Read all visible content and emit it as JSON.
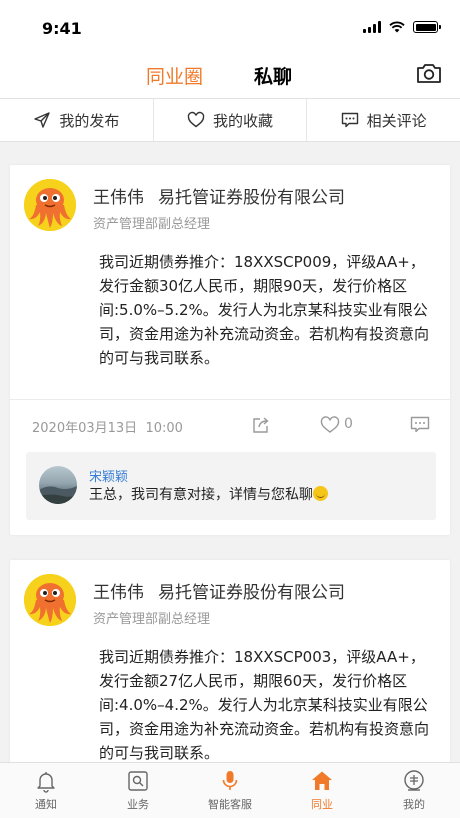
{
  "status": {
    "time": "9:41"
  },
  "header": {
    "tab_industry": "同业圈",
    "tab_private": "私聊"
  },
  "subtabs": [
    {
      "label": "我的发布",
      "icon": "send-icon"
    },
    {
      "label": "我的收藏",
      "icon": "heart-icon"
    },
    {
      "label": "相关评论",
      "icon": "comment-icon"
    }
  ],
  "posts": [
    {
      "author": "王伟伟",
      "company": "易托管证券股份有限公司",
      "title": "资产管理部副总经理",
      "text": "我司近期债券推介：18XXSCP009，评级AA+，发行金额30亿人民币，期限90天，发行价格区间:5.0%–5.2%。发行人为北京某科技实业有限公司，资金用途为补充流动资金。若机构有投资意向的可与我司联系。",
      "date": "2020年03月13日",
      "time": "10:00",
      "likes": "0",
      "reply": {
        "name": "宋颖颖",
        "text": "王总，我司有意对接，详情与您私聊"
      }
    },
    {
      "author": "王伟伟",
      "company": "易托管证券股份有限公司",
      "title": "资产管理部副总经理",
      "text": "我司近期债券推介：18XXSCP003，评级AA+，发行金额27亿人民币，期限60天，发行价格区间:4.0%–4.2%。发行人为北京某科技实业有限公司，资金用途为补充流动资金。若机构有投资意向的可与我司联系。"
    }
  ],
  "tabbar": [
    {
      "label": "通知",
      "icon": "bell-icon"
    },
    {
      "label": "业务",
      "icon": "business-icon"
    },
    {
      "label": "智能客服",
      "icon": "microphone-icon"
    },
    {
      "label": "同业",
      "icon": "home-icon"
    },
    {
      "label": "我的",
      "icon": "profile-badge-icon"
    }
  ],
  "colors": {
    "accent": "#f07a2a",
    "link": "#3a7fd5",
    "avatar_bg": "#f7d21d"
  }
}
